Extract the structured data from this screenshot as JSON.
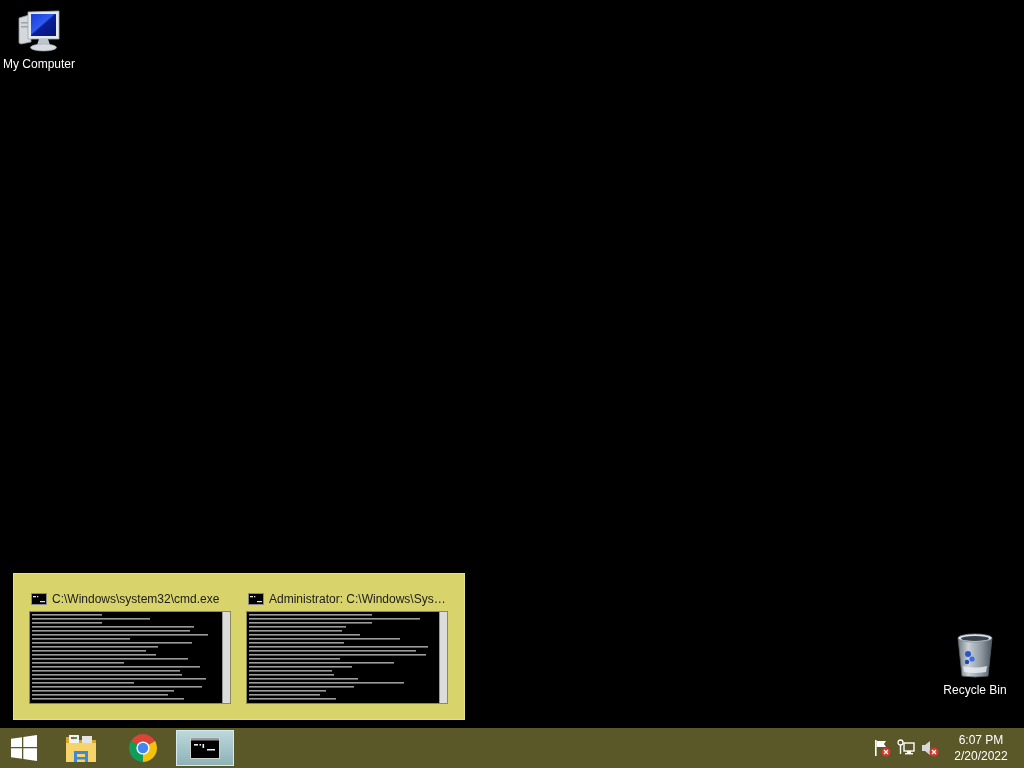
{
  "desktop_icons": [
    {
      "label": "My Computer",
      "kind": "computer"
    },
    {
      "label": "Recycle Bin",
      "kind": "recycle-bin"
    }
  ],
  "thumbnail_popup": {
    "windows": [
      {
        "title": "C:\\Windows\\system32\\cmd.exe"
      },
      {
        "title": "Administrator: C:\\Windows\\Sys…"
      }
    ]
  },
  "taskbar": {
    "buttons": [
      {
        "kind": "start",
        "selected": false
      },
      {
        "kind": "file-explorer",
        "selected": false
      },
      {
        "kind": "browser",
        "selected": false
      },
      {
        "kind": "command-prompt",
        "selected": true
      }
    ],
    "tray_icons": [
      {
        "kind": "flag",
        "error": true
      },
      {
        "kind": "network",
        "error": false
      },
      {
        "kind": "speaker",
        "error": true
      }
    ],
    "clock": {
      "time": "6:07 PM",
      "date": "2/20/2022"
    }
  }
}
